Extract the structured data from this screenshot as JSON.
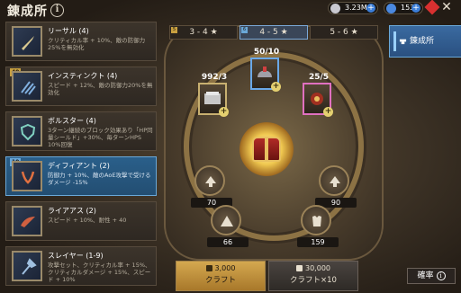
{
  "header": {
    "title": "錬成所",
    "info_icon": "i",
    "resources": [
      {
        "icon": "silver-coin-icon",
        "value": "3.23M"
      },
      {
        "icon": "gem-icon",
        "value": "153"
      },
      {
        "icon": "ruby-icon",
        "value": ""
      }
    ],
    "close_icon": "✕"
  },
  "sets": [
    {
      "level": "",
      "name": "リーサル (4)",
      "desc": "クリティカル率 + 10%、敵の防御力25%を無効化"
    },
    {
      "level": "40",
      "name": "インスティンクト (4)",
      "desc": "スピード + 12%、敵の防御力20%を無効化"
    },
    {
      "level": "",
      "name": "ボルスター (4)",
      "desc": "3ターン継続のブロック効果あり「HP同量シールド」+30%、毎ターンHPS 10%回復"
    },
    {
      "level": "10",
      "name": "ディフィアント (2)",
      "desc": "防御力 + 10%、敵のAoE攻撃で受けるダメージ -15%"
    },
    {
      "level": "",
      "name": "ライアアス (2)",
      "desc": "スピード + 10%、耐性 + 40"
    },
    {
      "level": "",
      "name": "スレイヤー (1-9)",
      "desc": "攻撃セット、クリティカル率 + 15%、クリティカルダメージ + 15%、スピード + 10%"
    }
  ],
  "tabs": [
    {
      "corner": "5",
      "label": "3 - 4 ★"
    },
    {
      "corner": "6",
      "label": "4 - 5 ★"
    },
    {
      "corner": "",
      "label": "5 - 6 ★"
    }
  ],
  "materials": [
    {
      "count": "992/3",
      "icon": "ingot-icon"
    },
    {
      "count": "50/10",
      "icon": "helmet-icon"
    },
    {
      "count": "25/5",
      "icon": "relic-icon"
    }
  ],
  "slots": [
    {
      "value": "70"
    },
    {
      "value": "90"
    },
    {
      "value": "66"
    },
    {
      "value": "159"
    }
  ],
  "craft": {
    "single_cost": "3,000",
    "single_label": "クラフト",
    "multi_cost": "30,000",
    "multi_label": "クラフト×10"
  },
  "side_tab": {
    "label": "錬成所"
  },
  "rates": {
    "label": "確率",
    "icon": "i"
  },
  "colors": {
    "accent_blue": "#6aa8d8",
    "gold": "#d4a850",
    "active_set": "#2a5f8a"
  }
}
